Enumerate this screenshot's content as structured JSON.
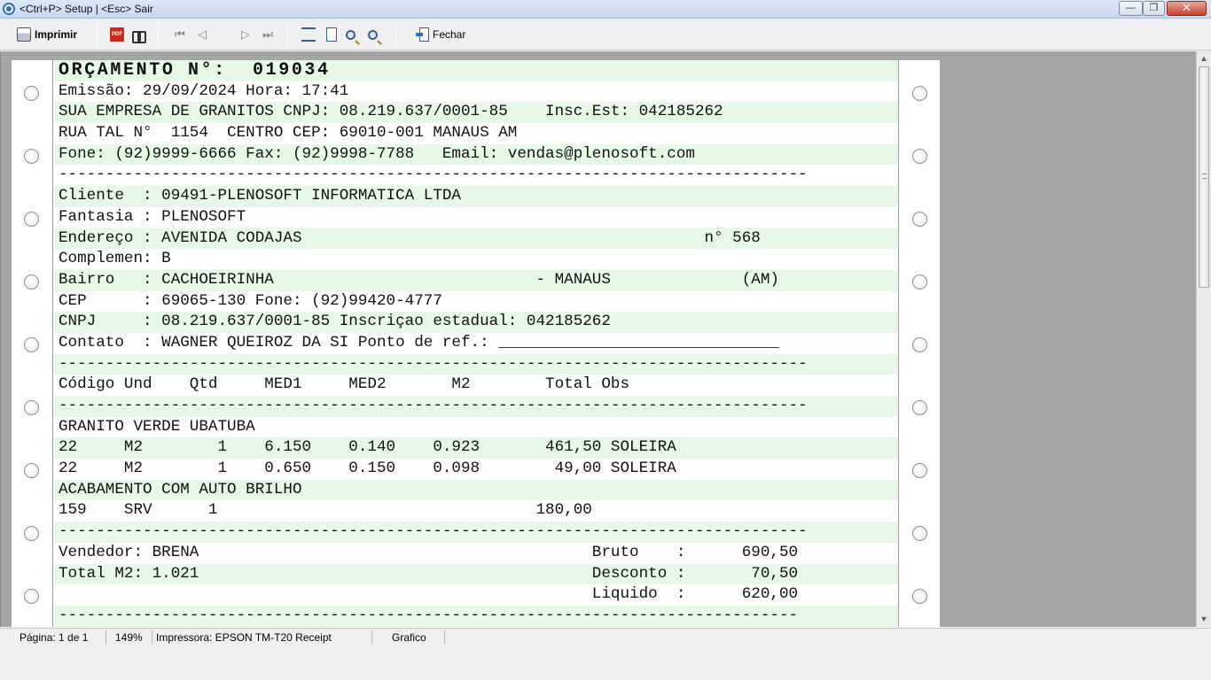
{
  "window": {
    "title": "<Ctrl+P> Setup | <Esc> Sair",
    "minimize": "—",
    "maximize": "❐",
    "close": "✕"
  },
  "toolbar": {
    "print_label": "Imprimir",
    "close_label": "Fechar",
    "icons": [
      "printer-icon",
      "pdf-icon",
      "binoculars-icon",
      "first-page-icon",
      "previous-page-icon",
      "next-page-icon",
      "last-page-icon",
      "page-width-icon",
      "whole-page-icon",
      "zoom-in-icon",
      "zoom-out-icon",
      "exit-icon"
    ]
  },
  "document": {
    "title_line": "ORÇAMENTO N°:  019034",
    "lines": [
      {
        "text": "Emissão: 29/09/2024 Hora: 17:41",
        "shaded": false
      },
      {
        "text": "SUA EMPRESA DE GRANITOS CNPJ: 08.219.637/0001-85    Insc.Est: 042185262",
        "shaded": true
      },
      {
        "text": "RUA TAL N°  1154  CENTRO CEP: 69010-001 MANAUS AM",
        "shaded": false
      },
      {
        "text": "Fone: (92)9999-6666 Fax: (92)9998-7788   Email: vendas@plenosoft.com",
        "shaded": true
      },
      {
        "text": "--------------------------------------------------------------------------------",
        "shaded": false
      },
      {
        "text": "Cliente  : 09491-PLENOSOFT INFORMATICA LTDA",
        "shaded": true
      },
      {
        "text": "Fantasia : PLENOSOFT",
        "shaded": false
      },
      {
        "text": "Endereço : AVENIDA CODAJAS                                           n° 568",
        "shaded": true
      },
      {
        "text": "Complemen: B",
        "shaded": false
      },
      {
        "text": "Bairro   : CACHOEIRINHA                            - MANAUS              (AM)",
        "shaded": true
      },
      {
        "text": "CEP      : 69065-130 Fone: (92)99420-4777",
        "shaded": false
      },
      {
        "text": "CNPJ     : 08.219.637/0001-85 Inscriçao estadual: 042185262",
        "shaded": true
      },
      {
        "text": "Contato  : WAGNER QUEIROZ DA SI Ponto de ref.: ______________________________",
        "shaded": false
      },
      {
        "text": "--------------------------------------------------------------------------------",
        "shaded": true
      },
      {
        "text": "Código Und    Qtd     MED1     MED2       M2        Total Obs",
        "shaded": false
      },
      {
        "text": "--------------------------------------------------------------------------------",
        "shaded": true
      },
      {
        "text": "GRANITO VERDE UBATUBA",
        "shaded": false
      },
      {
        "text": "22     M2        1    6.150    0.140    0.923       461,50 SOLEIRA",
        "shaded": true
      },
      {
        "text": "22     M2        1    0.650    0.150    0.098        49,00 SOLEIRA",
        "shaded": false
      },
      {
        "text": "ACABAMENTO COM AUTO BRILHO",
        "shaded": true
      },
      {
        "text": "159    SRV      1                                  180,00",
        "shaded": false
      },
      {
        "text": "--------------------------------------------------------------------------------",
        "shaded": true
      },
      {
        "text": "Vendedor: BRENA                                          Bruto    :      690,50",
        "shaded": false
      },
      {
        "text": "Total M2: 1.021                                          Desconto :       70,50",
        "shaded": true
      },
      {
        "text": "                                                         Liquido  :      620,00",
        "shaded": false
      },
      {
        "text": "-------------------------------------------------------------------------------",
        "shaded": true
      }
    ]
  },
  "statusbar": {
    "page": "Página: 1 de 1",
    "zoom": "149%",
    "printer": "Impressora: EPSON TM-T20 Receipt",
    "mode": "Grafico"
  }
}
